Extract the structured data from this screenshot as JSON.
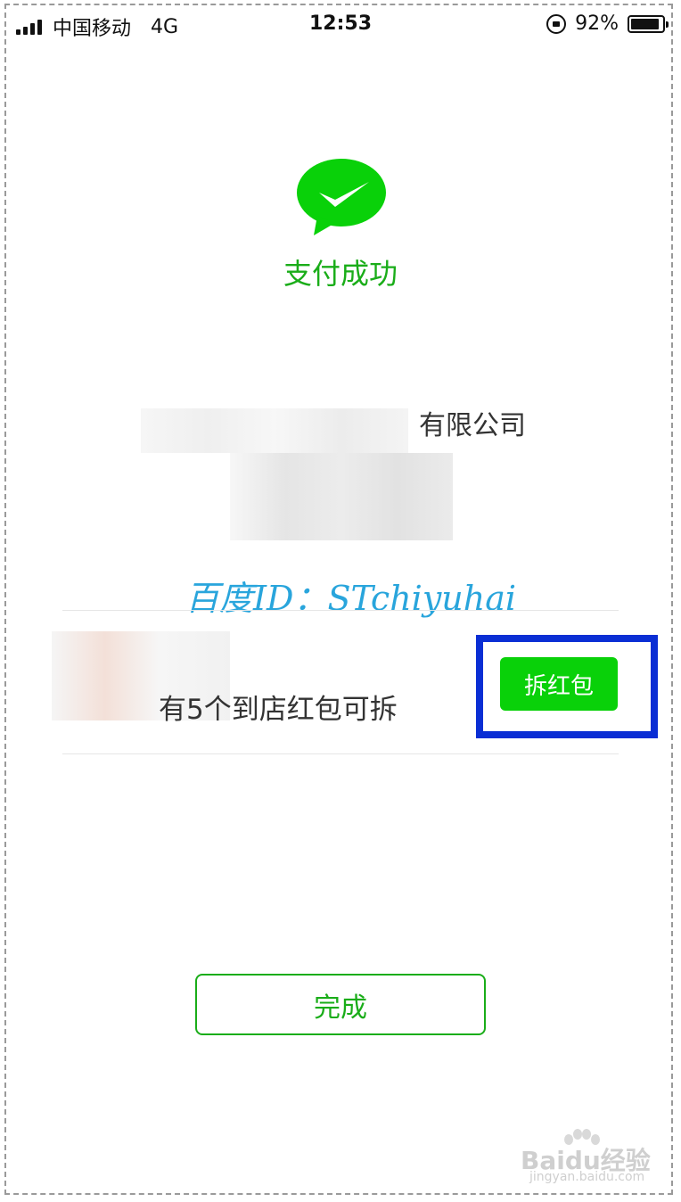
{
  "status_bar": {
    "carrier": "中国移动",
    "network": "4G",
    "time": "12:53",
    "battery": "92%",
    "battery_level": 0.92
  },
  "payment": {
    "title": "支付成功",
    "merchant_suffix": "有限公司"
  },
  "watermark": "百度ID：STchiyuhai",
  "red_packet": {
    "promo_text": "有5个到店红包可拆",
    "open_label": "拆红包"
  },
  "done_label": "完成",
  "site_mark": {
    "brand": "Baidu经验",
    "domain": "jingyan.baidu.com"
  },
  "colors": {
    "wechat_green": "#1aad19",
    "button_green": "#09d109",
    "highlight_blue": "#0a2ed4",
    "watermark_blue": "#29a5dc"
  },
  "icons": [
    "signal-icon",
    "rotation-lock-icon",
    "battery-icon",
    "wechat-pay-check-icon",
    "baidu-paw-icon"
  ]
}
